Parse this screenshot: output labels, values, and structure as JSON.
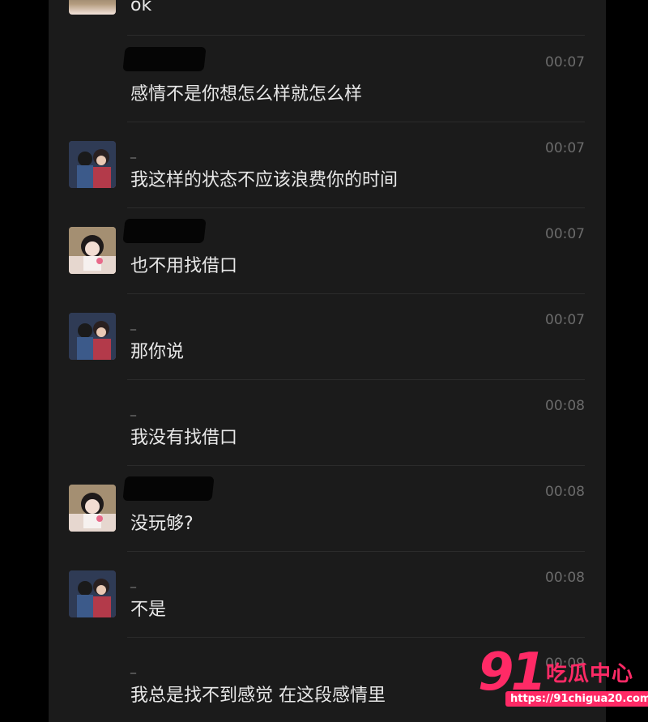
{
  "messages": [
    {
      "sender": "_",
      "time": "",
      "text": "ok"
    },
    {
      "sender": "",
      "time": "00:07",
      "text": "感情不是你想怎么样就怎么样"
    },
    {
      "sender": "_",
      "time": "00:07",
      "text": "我这样的状态不应该浪费你的时间"
    },
    {
      "sender": "",
      "time": "00:07",
      "text": "也不用找借口"
    },
    {
      "sender": "_",
      "time": "00:07",
      "text": "那你说"
    },
    {
      "sender": "_",
      "time": "00:08",
      "text": "我没有找借口"
    },
    {
      "sender": "",
      "time": "00:08",
      "text": "没玩够?"
    },
    {
      "sender": "_",
      "time": "00:08",
      "text": "不是"
    },
    {
      "sender": "_",
      "time": "00:09",
      "text": "我总是找不到感觉 在这段感情里"
    }
  ],
  "watermark": {
    "number": "91",
    "brand": "吃瓜中心",
    "url": "https://91chigua20.com"
  },
  "colors": {
    "background": "#1b1b1b",
    "text": "#e8e8e8",
    "time": "#6b6b6b",
    "watermark": "#ff2a66"
  }
}
